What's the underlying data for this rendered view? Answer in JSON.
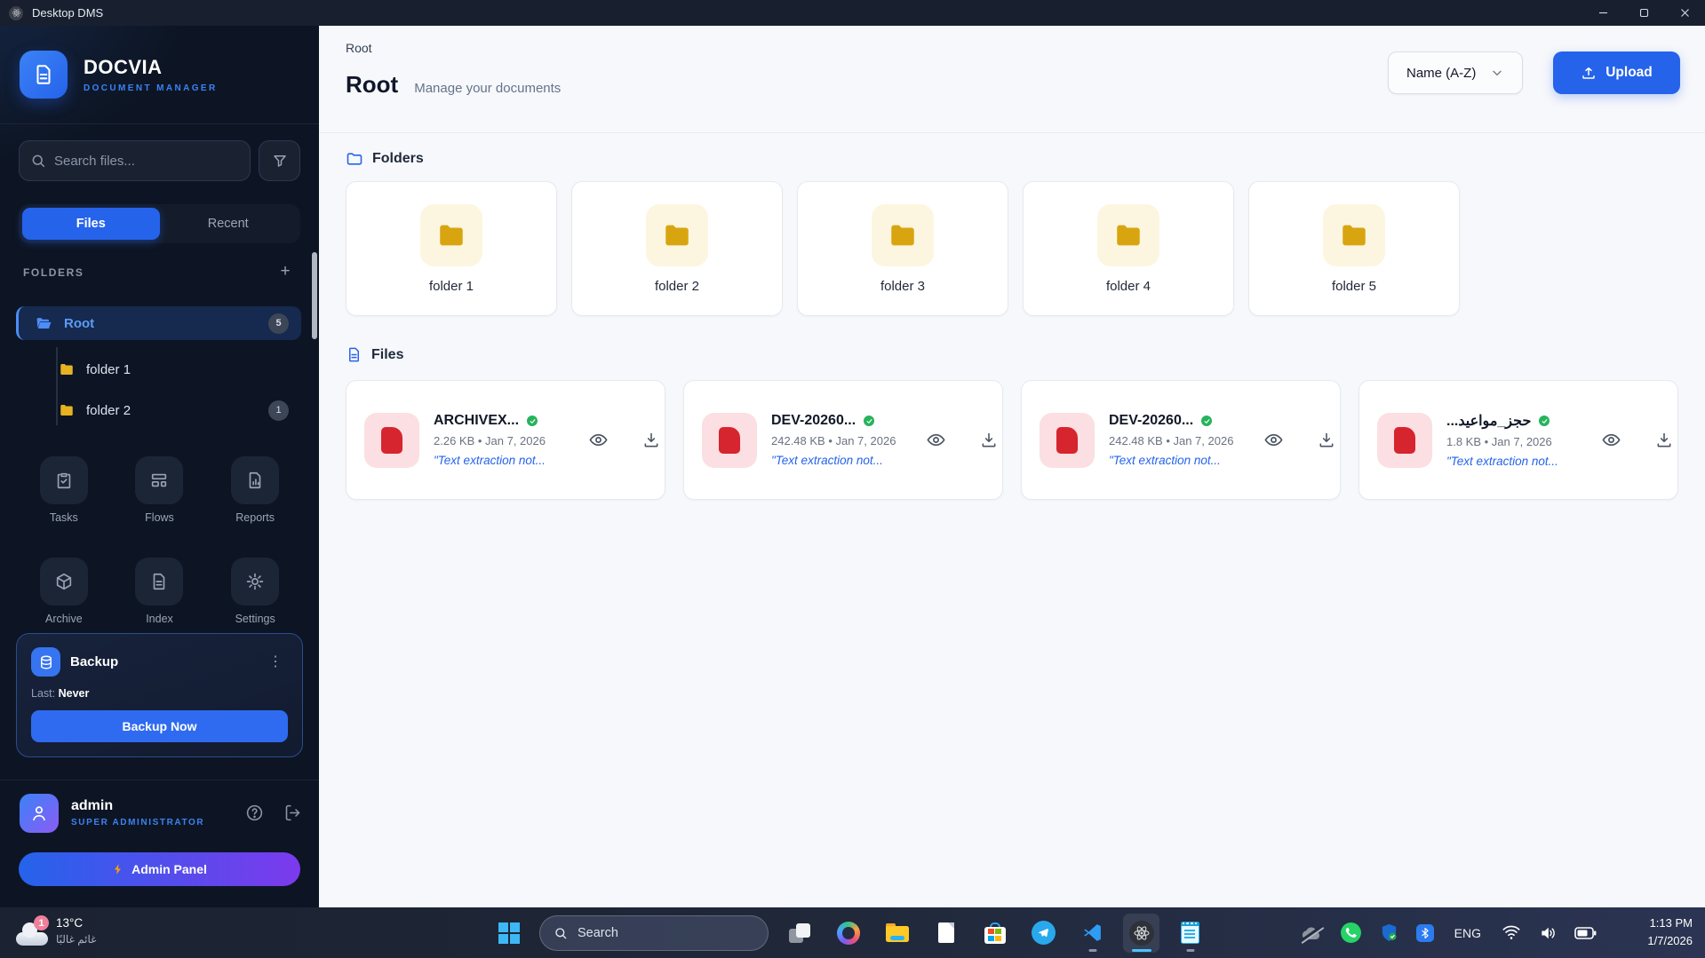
{
  "window": {
    "title": "Desktop DMS"
  },
  "icons": {
    "plus": "+",
    "kebab": "⋮"
  },
  "colors": {
    "accent": "#2563eb",
    "folder": "#d8a511",
    "danger": "#d6252e",
    "success": "#27b35c"
  },
  "sidebar": {
    "brand": {
      "name": "DOCVIA",
      "subtitle": "DOCUMENT MANAGER"
    },
    "search_placeholder": "Search files...",
    "tabs": [
      {
        "label": "Files"
      },
      {
        "label": "Recent"
      }
    ],
    "folders_label": "FOLDERS",
    "tree": [
      {
        "label": "Root",
        "badge": "5"
      },
      {
        "label": "folder 1",
        "badge": ""
      },
      {
        "label": "folder 2",
        "badge": "1"
      }
    ],
    "nav": [
      {
        "label": "Tasks"
      },
      {
        "label": "Flows"
      },
      {
        "label": "Reports"
      },
      {
        "label": "Archive"
      },
      {
        "label": "Index"
      },
      {
        "label": "Settings"
      }
    ],
    "backup": {
      "title": "Backup",
      "last_label": "Last:",
      "last_value": "Never",
      "button": "Backup Now"
    },
    "user": {
      "name": "admin",
      "role": "SUPER ADMINISTRATOR"
    },
    "admin_button": "Admin Panel"
  },
  "main": {
    "breadcrumb": "Root",
    "title": "Root",
    "subtitle": "Manage your documents",
    "sort_label": "Name (A-Z)",
    "upload_label": "Upload",
    "folders_section": "Folders",
    "files_section": "Files",
    "folders": [
      {
        "label": "folder 1"
      },
      {
        "label": "folder 2"
      },
      {
        "label": "folder 3"
      },
      {
        "label": "folder 4"
      },
      {
        "label": "folder 5"
      }
    ],
    "files": [
      {
        "name": "ARCHIVEX...",
        "meta": "2.26 KB • Jan 7, 2026",
        "note": "\"Text extraction not..."
      },
      {
        "name": "DEV-20260...",
        "meta": "242.48 KB • Jan 7, 2026",
        "note": "\"Text extraction not..."
      },
      {
        "name": "DEV-20260...",
        "meta": "242.48 KB • Jan 7, 2026",
        "note": "\"Text extraction not..."
      },
      {
        "name": "حجز_مواعيد...",
        "meta": "1.8 KB • Jan 7, 2026",
        "note": "\"Text extraction not..."
      }
    ]
  },
  "taskbar": {
    "weather": {
      "badge": "1",
      "temp": "13°C",
      "condition": "غائم غالبًا"
    },
    "search_label": "Search",
    "pinned": [
      "task-view",
      "copilot",
      "file-explorer",
      "notepad-file",
      "microsoft-store",
      "telegram",
      "vscode",
      "desktop-dms",
      "notepad"
    ],
    "tray": {
      "lang": "ENG",
      "time": "1:13 PM",
      "date": "1/7/2026"
    }
  }
}
